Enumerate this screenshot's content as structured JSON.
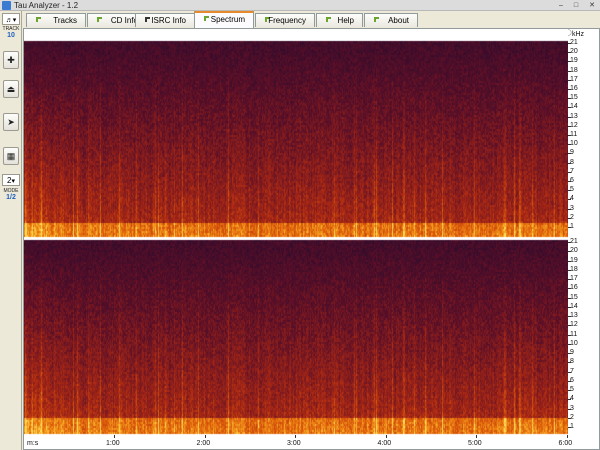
{
  "window": {
    "title": "Tau Analyzer - 1.2"
  },
  "tools": {
    "dropdown_label": "TRACK",
    "track_number": "10",
    "mode_value": "2",
    "mode_label": "MODE",
    "mode_value_full": "1/2",
    "buttons": [
      "add-icon",
      "eject-icon",
      "arrow-right-icon",
      "grid-icon"
    ]
  },
  "tabs": [
    {
      "label": "Tracks",
      "active": false,
      "marker": "green"
    },
    {
      "label": "CD Info",
      "active": false,
      "marker": "green"
    },
    {
      "label": "ISRC Info",
      "active": false,
      "marker": "black"
    },
    {
      "label": "Spectrum",
      "active": true,
      "marker": "green"
    },
    {
      "label": "Frequency",
      "active": false,
      "marker": "green"
    },
    {
      "label": "Help",
      "active": false,
      "marker": "green"
    },
    {
      "label": "About",
      "active": false,
      "marker": "green"
    }
  ],
  "spectrum": {
    "unit": "kHz",
    "freq_ticks": [
      "21",
      "20",
      "19",
      "18",
      "17",
      "16",
      "15",
      "14",
      "13",
      "12",
      "11",
      "10",
      "9",
      "8",
      "7",
      "6",
      "5",
      "4",
      "3",
      "2",
      "1"
    ],
    "time_unit": "m:s",
    "time_ticks": [
      "1:00",
      "2:00",
      "3:00",
      "4:00",
      "5:00",
      "6:00"
    ],
    "channels": 2,
    "colors": {
      "low": "#1a0a2e",
      "mid": "#c8321a",
      "high": "#ffd24a"
    }
  }
}
